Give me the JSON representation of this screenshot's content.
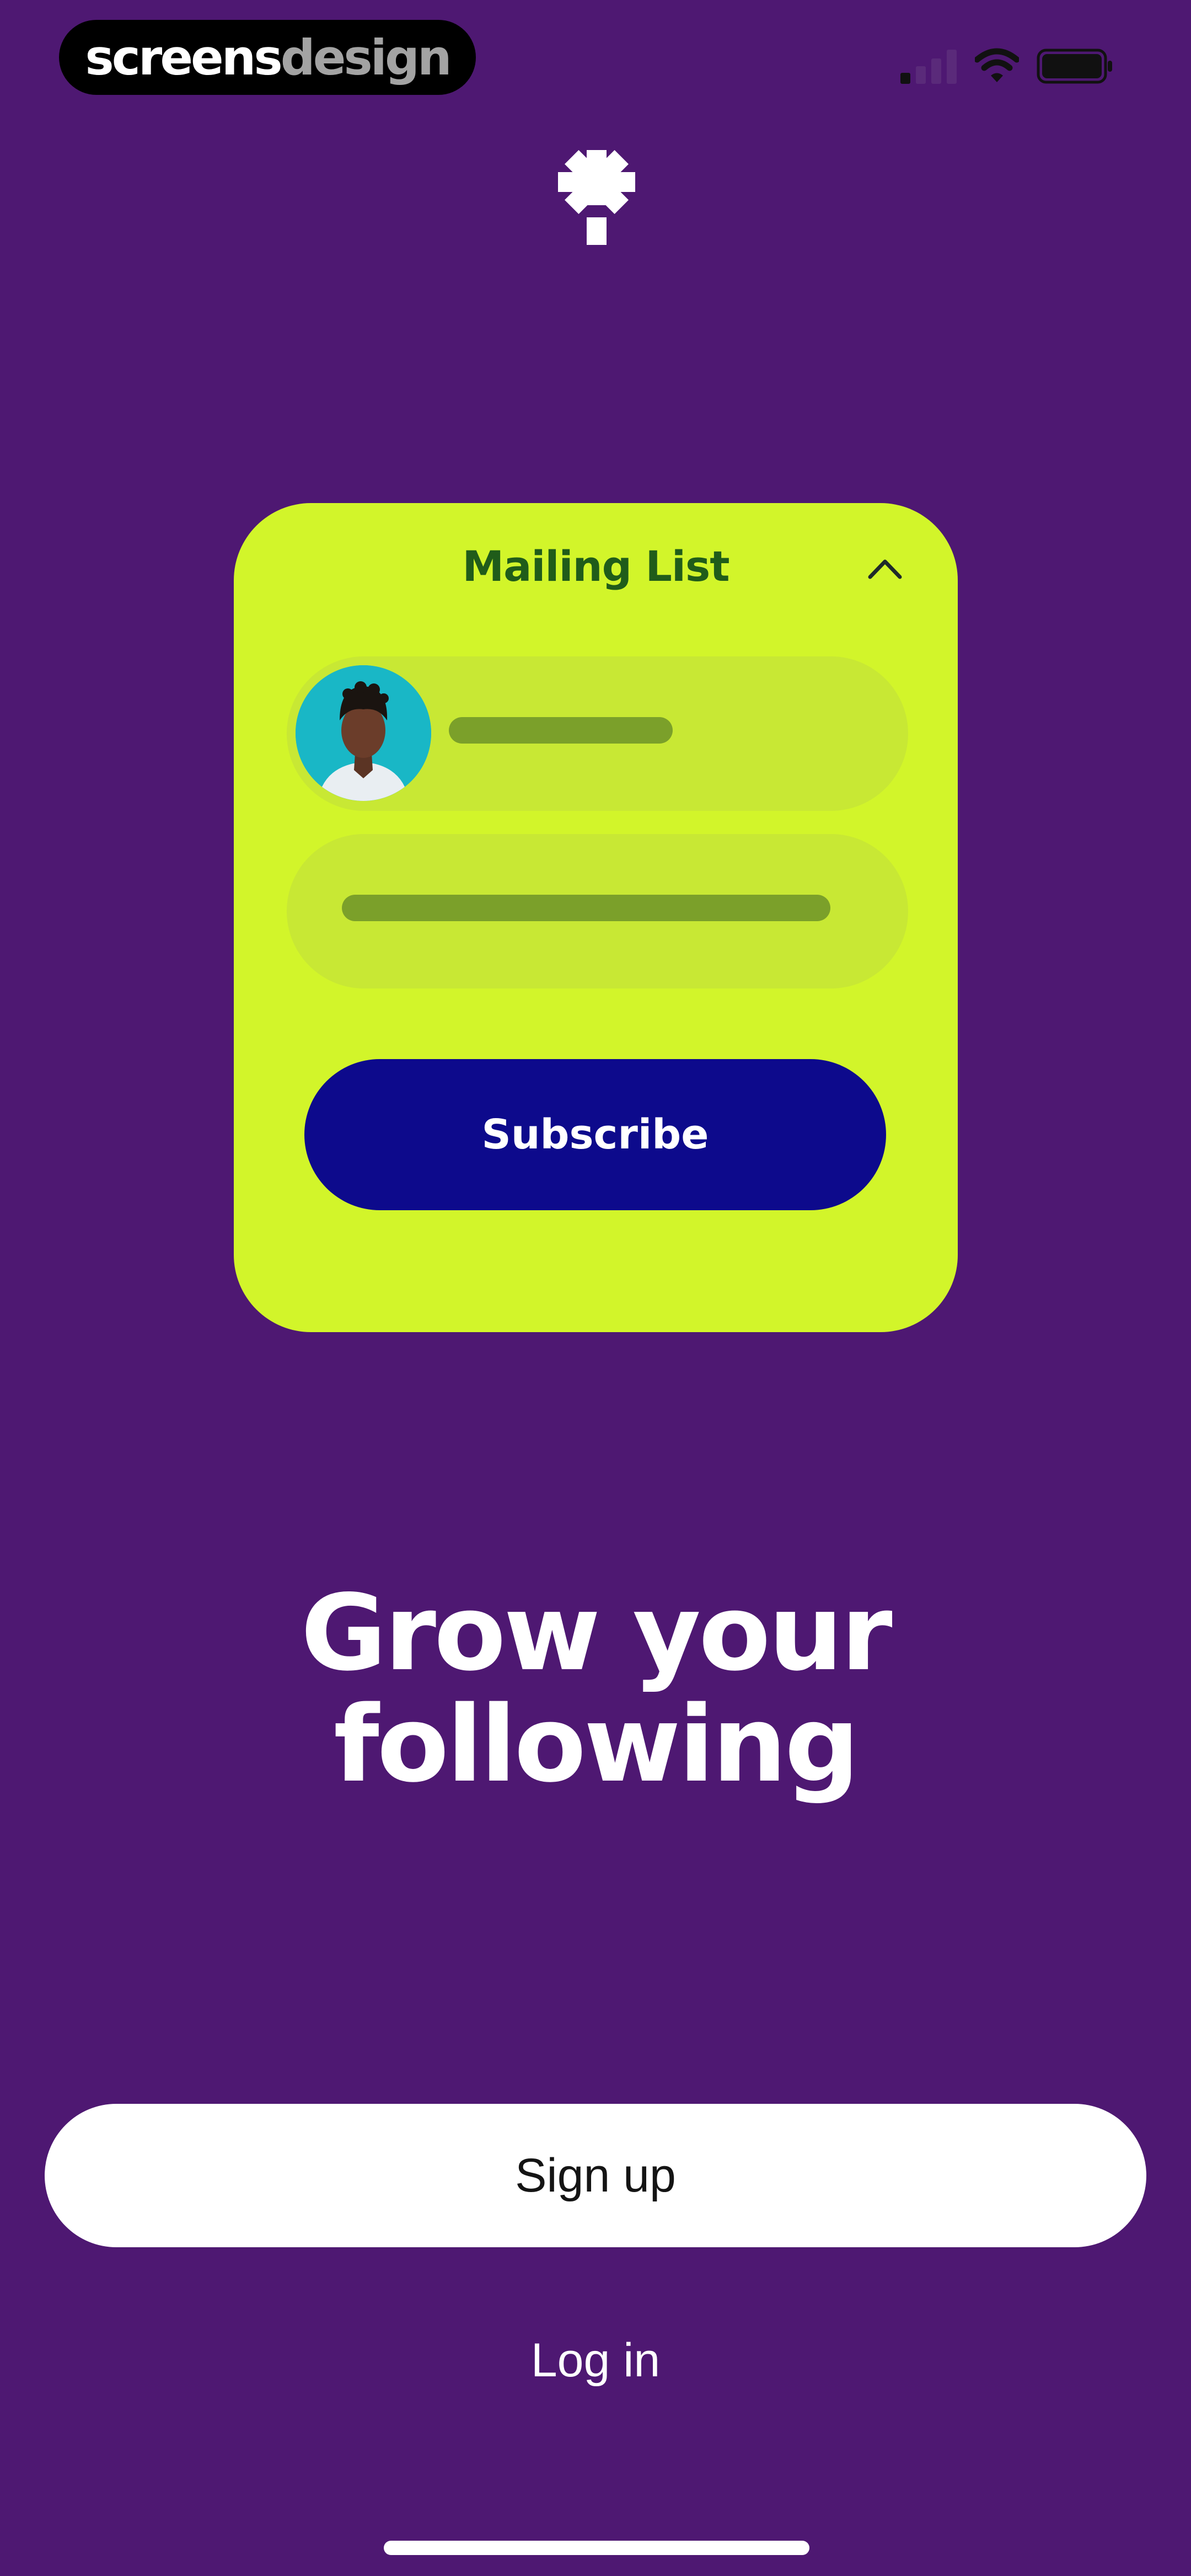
{
  "status_bar": {
    "brand_primary": "screens",
    "brand_secondary": "design"
  },
  "card": {
    "title": "Mailing List",
    "subscribe_label": "Subscribe"
  },
  "headline": {
    "line1": "Grow your",
    "line2": "following"
  },
  "actions": {
    "signup_label": "Sign up",
    "login_label": "Log in"
  },
  "colors": {
    "background": "#4e1872",
    "card": "#d2f52a",
    "card_field": "#c8e834",
    "placeholder_bar": "#7ba02a",
    "subscribe_button": "#0d0a8c",
    "card_title": "#205c1a",
    "avatar_background": "#19b7c6"
  },
  "icons": {
    "logo": "linktree-asterisk-icon",
    "card_toggle": "chevron-up-icon",
    "signal": "cellular-signal-icon",
    "wifi": "wifi-icon",
    "battery": "battery-icon"
  }
}
